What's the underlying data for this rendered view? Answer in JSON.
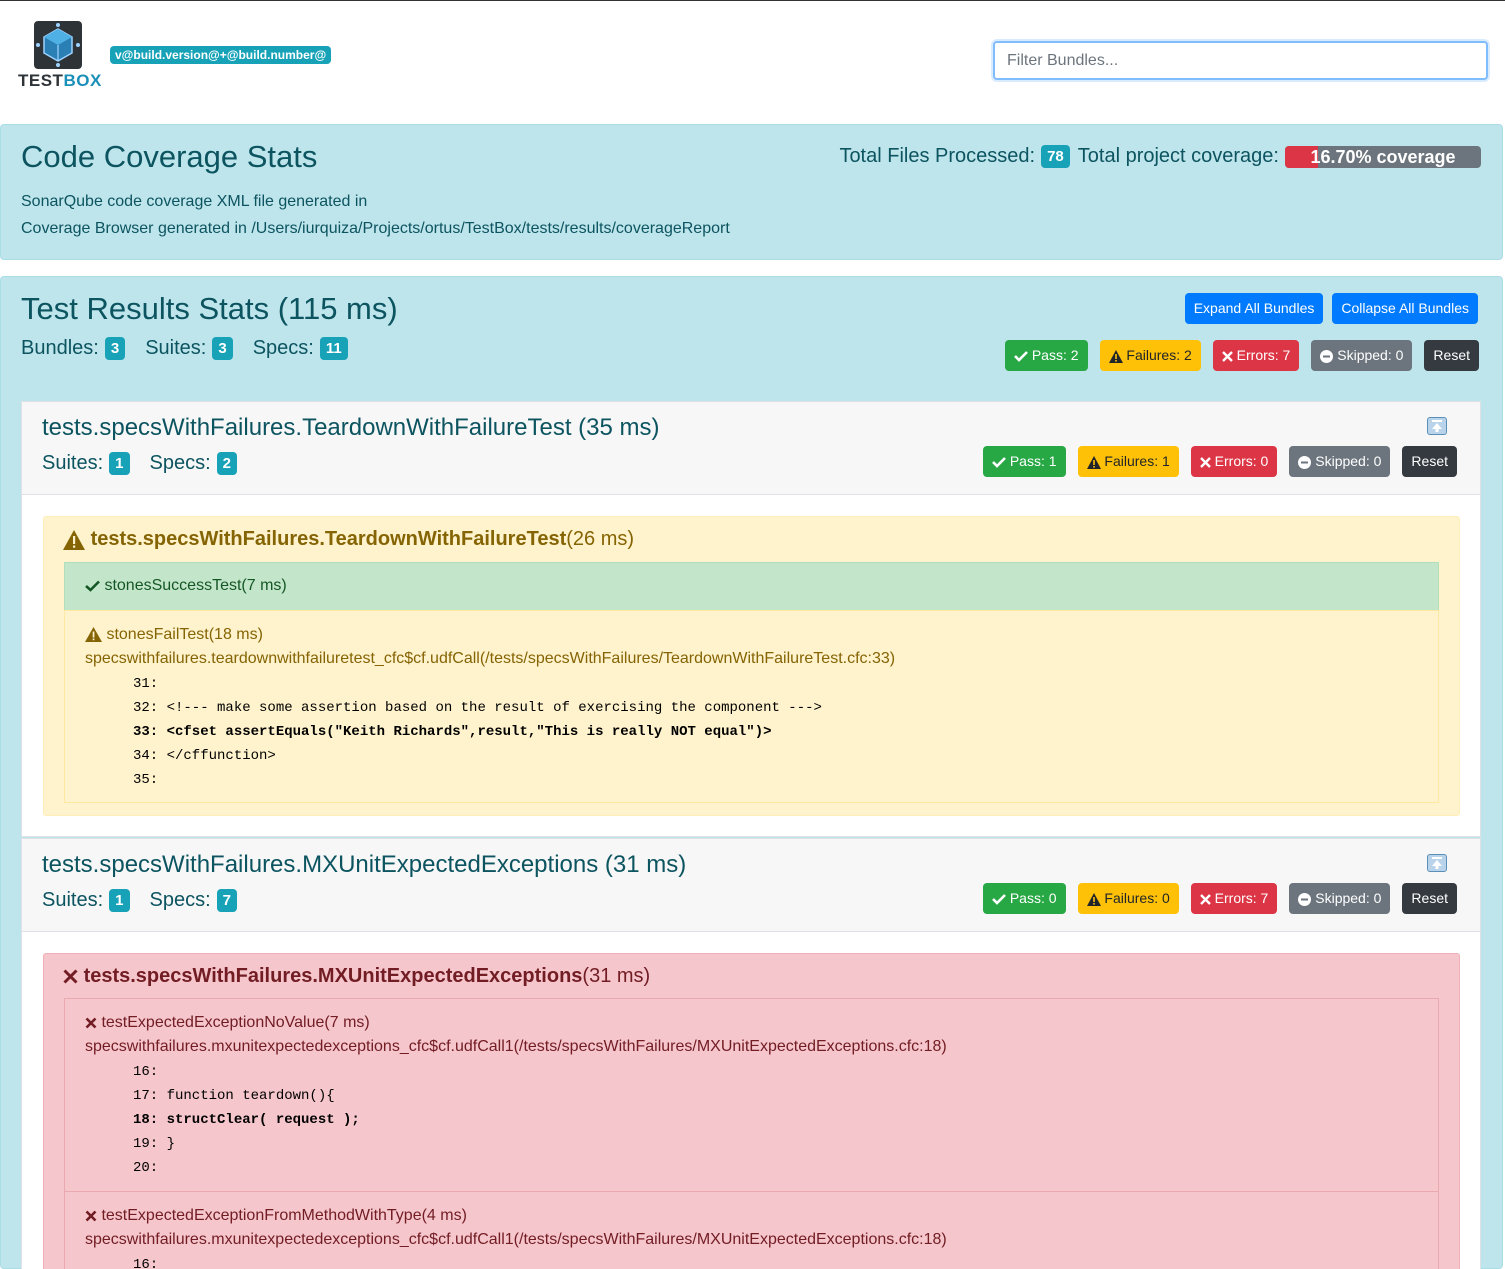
{
  "header": {
    "logo_text_a": "TEST",
    "logo_text_b": "BOX",
    "version": "v@build.version@+@build.number@",
    "filter_placeholder": "Filter Bundles..."
  },
  "coverage": {
    "title": "Code Coverage Stats",
    "files_label": "Total Files Processed:",
    "files_count": "78",
    "project_label": "Total project coverage:",
    "coverage_percent": 16.7,
    "coverage_text": "16.70% coverage",
    "line1": "SonarQube code coverage XML file generated in",
    "line2": "Coverage Browser generated in /Users/iurquiza/Projects/ortus/TestBox/tests/results/coverageReport"
  },
  "results": {
    "title": "Test Results Stats (115 ms)",
    "bundles_label": "Bundles:",
    "bundles": "3",
    "suites_label": "Suites:",
    "suites": "3",
    "specs_label": "Specs:",
    "specs": "11",
    "expand_label": "Expand All Bundles",
    "collapse_label": "Collapse All Bundles",
    "pass": "Pass: 2",
    "failures": "Failures: 2",
    "errors": "Errors: 7",
    "skipped": "Skipped: 0",
    "reset": "Reset"
  },
  "bundles": [
    {
      "title": "tests.specsWithFailures.TeardownWithFailureTest (35 ms)",
      "suites_label": "Suites:",
      "suites": "1",
      "specs_label": "Specs:",
      "specs": "2",
      "pass": "Pass: 1",
      "failures": "Failures: 1",
      "errors": "Errors: 0",
      "skipped": "Skipped: 0",
      "reset": "Reset",
      "suite_name": "tests.specsWithFailures.TeardownWithFailureTest",
      "suite_time": "(26 ms)",
      "spec1": "stonesSuccessTest(7 ms)",
      "spec2": "stonesFailTest(18 ms)",
      "spec2_trace": "specswithfailures.teardownwithfailuretest_cfc$cf.udfCall(/tests/specsWithFailures/TeardownWithFailureTest.cfc:33)",
      "code": [
        "31:",
        "32: <!--- make some assertion based on the result of exercising the component --->",
        "33: <cfset assertEquals(\"Keith Richards\",result,\"This is really NOT equal\")>",
        "34: </cffunction>",
        "35:"
      ]
    },
    {
      "title": "tests.specsWithFailures.MXUnitExpectedExceptions (31 ms)",
      "suites_label": "Suites:",
      "suites": "1",
      "specs_label": "Specs:",
      "specs": "7",
      "pass": "Pass: 0",
      "failures": "Failures: 0",
      "errors": "Errors: 7",
      "skipped": "Skipped: 0",
      "reset": "Reset",
      "suite_name": "tests.specsWithFailures.MXUnitExpectedExceptions",
      "suite_time": "(31 ms)",
      "spec1": "testExpectedExceptionNoValue(7 ms)",
      "spec1_trace": "specswithfailures.mxunitexpectedexceptions_cfc$cf.udfCall1(/tests/specsWithFailures/MXUnitExpectedExceptions.cfc:18)",
      "code": [
        "16:",
        "17: function teardown(){",
        "18: structClear( request );",
        "19: }",
        "20:"
      ],
      "spec2": "testExpectedExceptionFromMethodWithType(4 ms)",
      "spec2_trace": "specswithfailures.mxunitexpectedexceptions_cfc$cf.udfCall1(/tests/specsWithFailures/MXUnitExpectedExceptions.cfc:18)",
      "code2_first": "16:"
    }
  ],
  "colors": {
    "info_bg": "#bee5eb",
    "info_text": "#0c5460",
    "pass": "#28a745",
    "failure": "#ffc107",
    "error": "#dc3545",
    "skipped": "#6c757d",
    "primary": "#007bff"
  },
  "icons": [
    "testbox-logo-icon",
    "check-icon",
    "warning-icon",
    "times-icon",
    "minus-circle-icon",
    "collapse-up-icon"
  ]
}
